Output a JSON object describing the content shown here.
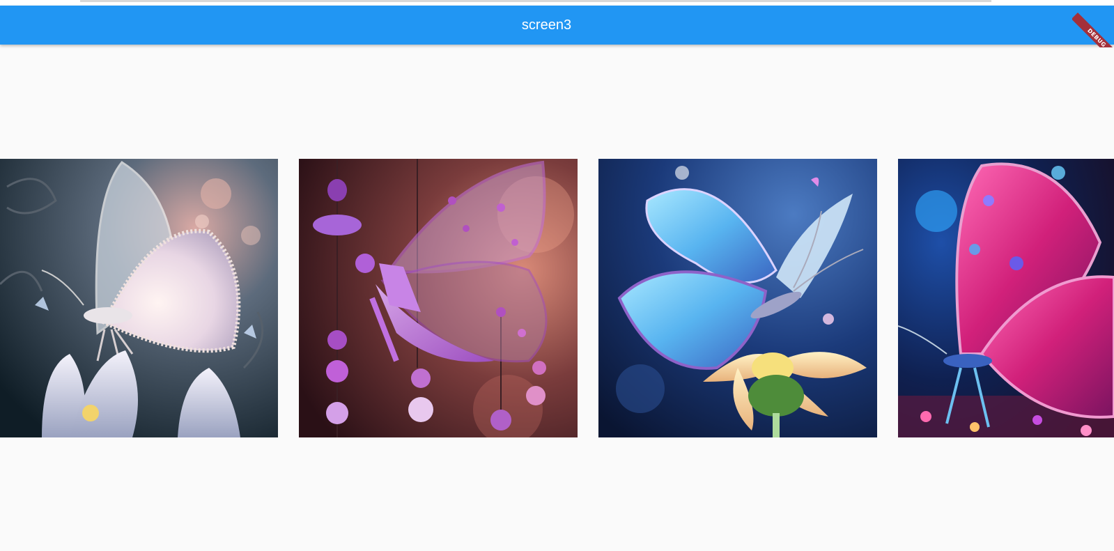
{
  "appbar": {
    "title": "screen3",
    "color": "#2196f3"
  },
  "debug_banner": {
    "label": "DEBUG",
    "color": "#a3303a"
  },
  "gallery": {
    "images": [
      {
        "name": "white-butterfly-image",
        "description_icon": "butterfly-image"
      },
      {
        "name": "purple-crystal-butterfly-image",
        "description_icon": "butterfly-image"
      },
      {
        "name": "blue-butterfly-image",
        "description_icon": "butterfly-image"
      },
      {
        "name": "pink-butterfly-image",
        "description_icon": "butterfly-image"
      }
    ]
  }
}
